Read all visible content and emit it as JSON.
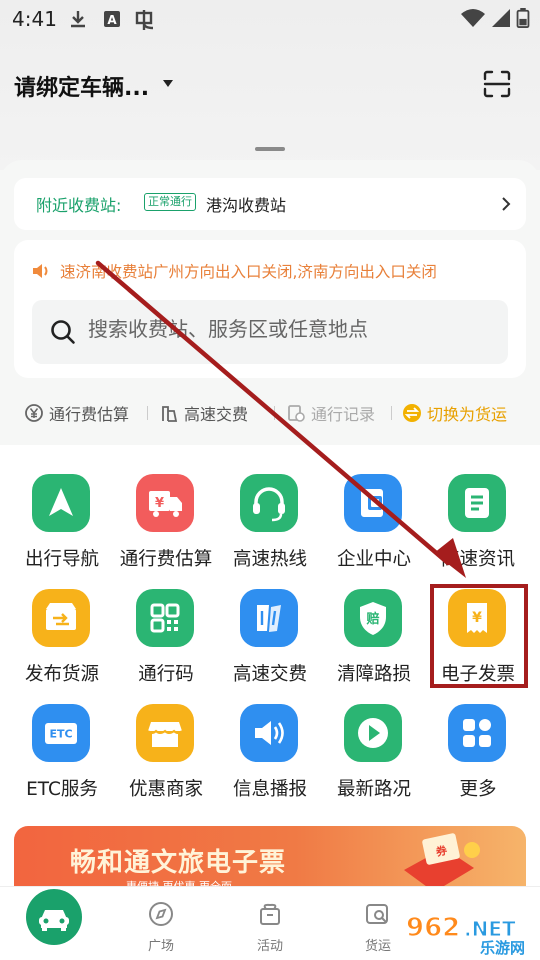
{
  "status_bar": {
    "time": "4:41",
    "left_icons": [
      "download-icon",
      "a-icon",
      "bug-icon"
    ],
    "right_icons": [
      "wifi-icon",
      "signal-icon",
      "battery-icon"
    ]
  },
  "header": {
    "title": "请绑定车辆...",
    "scan_icon": "scan-icon"
  },
  "toll_station": {
    "label": "附近收费站:",
    "badge": "正常通行",
    "name": "港沟收费站"
  },
  "notice": {
    "text": "速济南收费站广州方向出入口关闭,济南方向出入口关闭"
  },
  "search": {
    "placeholder": "搜索收费站、服务区或任意地点"
  },
  "quick_actions": [
    {
      "label": "通行费估算",
      "icon": "yen-circle-icon"
    },
    {
      "label": "高速交费",
      "icon": "pay-icon"
    },
    {
      "label": "通行记录",
      "icon": "record-icon"
    },
    {
      "label": "切换为货运",
      "icon": "switch-icon"
    }
  ],
  "grid": [
    {
      "label": "出行导航",
      "icon": "navigation-icon",
      "color": "#2bb573"
    },
    {
      "label": "通行费估算",
      "icon": "toll-truck-icon",
      "color": "#f25c5c"
    },
    {
      "label": "高速热线",
      "icon": "headset-icon",
      "color": "#2bb573"
    },
    {
      "label": "企业中心",
      "icon": "enterprise-icon",
      "color": "#2f8ff0"
    },
    {
      "label": "高速资讯",
      "icon": "news-icon",
      "color": "#2bb573"
    },
    {
      "label": "发布货源",
      "icon": "cargo-icon",
      "color": "#f7b21a"
    },
    {
      "label": "通行码",
      "icon": "qrcode-icon",
      "color": "#2bb573"
    },
    {
      "label": "高速交费",
      "icon": "pay-card-icon",
      "color": "#2f8ff0"
    },
    {
      "label": "清障路损",
      "icon": "compensation-icon",
      "color": "#2bb573"
    },
    {
      "label": "电子发票",
      "icon": "invoice-icon",
      "color": "#f7b21a"
    },
    {
      "label": "ETC服务",
      "icon": "etc-icon",
      "color": "#2f8ff0"
    },
    {
      "label": "优惠商家",
      "icon": "shop-icon",
      "color": "#f7b21a"
    },
    {
      "label": "信息播报",
      "icon": "broadcast-icon",
      "color": "#2f8ff0"
    },
    {
      "label": "最新路况",
      "icon": "play-icon",
      "color": "#2bb573"
    },
    {
      "label": "更多",
      "icon": "more-grid-icon",
      "color": "#2f8ff0"
    }
  ],
  "banner": {
    "title": "畅和通文旅电子票",
    "subtitle": "惠便捷  更优惠  更全面"
  },
  "bottom_nav": [
    {
      "label": "",
      "icon": "car-icon"
    },
    {
      "label": "广场",
      "icon": "compass-icon"
    },
    {
      "label": "活动",
      "icon": "gift-icon"
    },
    {
      "label": "货运",
      "icon": "truck-search-icon"
    }
  ],
  "watermark": {
    "brand": "962.NET",
    "sub": "乐游网"
  },
  "colors": {
    "primary_green": "#1aa16b",
    "notice_orange": "#e8803a",
    "accent_yellow": "#e8a000",
    "highlight_red": "#a51d1d"
  }
}
